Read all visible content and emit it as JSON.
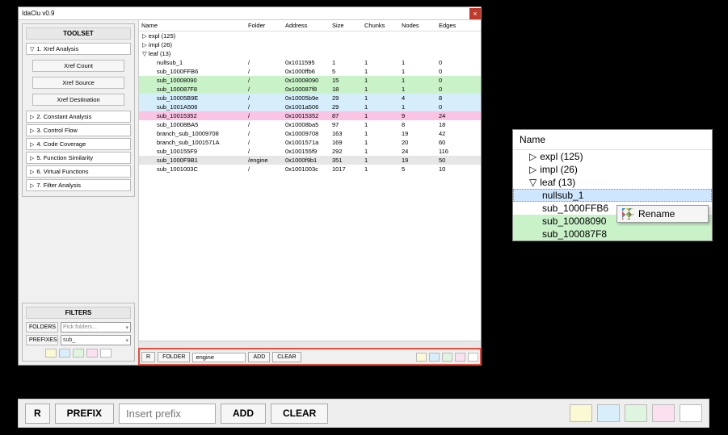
{
  "window": {
    "title": "IdaClu v0.9",
    "close": "×"
  },
  "toolset": {
    "title": "TOOLSET",
    "sections": [
      {
        "label": "1. Xref Analysis",
        "open": true,
        "items": [
          "Xref Count",
          "Xref Source",
          "Xref Destination"
        ]
      },
      {
        "label": "2. Constant Analysis",
        "open": false
      },
      {
        "label": "3. Control Flow",
        "open": false
      },
      {
        "label": "4. Code Coverage",
        "open": false
      },
      {
        "label": "5. Function Similarity",
        "open": false
      },
      {
        "label": "6. Virtual Functions",
        "open": false
      },
      {
        "label": "7. Filter Analysis",
        "open": false
      }
    ]
  },
  "filters": {
    "title": "FILTERS",
    "folders_label": "FOLDERS",
    "folders_placeholder": "Pick folders...",
    "prefixes_label": "PREFIXES",
    "prefixes_value": "sub_"
  },
  "palette": [
    "#fbf9d4",
    "#d9eefb",
    "#dff5df",
    "#fbe0f0",
    "#ffffff"
  ],
  "columns": [
    "Name",
    "Folder",
    "Address",
    "Size",
    "Chunks",
    "Nodes",
    "Edges"
  ],
  "groups": [
    {
      "label": "expl (125)",
      "open": false
    },
    {
      "label": "impl (26)",
      "open": false
    },
    {
      "label": "leaf (13)",
      "open": true
    }
  ],
  "rows": [
    {
      "name": "nullsub_1",
      "folder": "/",
      "addr": "0x1011595",
      "size": "1",
      "chunks": "1",
      "nodes": "1",
      "edges": "0",
      "bg": "#ffffff"
    },
    {
      "name": "sub_1000FFB6",
      "folder": "/",
      "addr": "0x1000ffb6",
      "size": "5",
      "chunks": "1",
      "nodes": "1",
      "edges": "0",
      "bg": "#ffffff"
    },
    {
      "name": "sub_10008090",
      "folder": "/",
      "addr": "0x10008090",
      "size": "15",
      "chunks": "1",
      "nodes": "1",
      "edges": "0",
      "bg": "#c9f2c9"
    },
    {
      "name": "sub_100087F8",
      "folder": "/",
      "addr": "0x100087f8",
      "size": "18",
      "chunks": "1",
      "nodes": "1",
      "edges": "0",
      "bg": "#c9f2c9"
    },
    {
      "name": "sub_10005B9E",
      "folder": "/",
      "addr": "0x10005b9e",
      "size": "29",
      "chunks": "1",
      "nodes": "4",
      "edges": "8",
      "bg": "#d6eefc"
    },
    {
      "name": "sub_1001A506",
      "folder": "/",
      "addr": "0x1001a506",
      "size": "29",
      "chunks": "1",
      "nodes": "1",
      "edges": "0",
      "bg": "#d6eefc"
    },
    {
      "name": "sub_10015352",
      "folder": "/",
      "addr": "0x10015352",
      "size": "87",
      "chunks": "1",
      "nodes": "9",
      "edges": "24",
      "bg": "#fbc3e4"
    },
    {
      "name": "sub_10008BA5",
      "folder": "/",
      "addr": "0x10008ba5",
      "size": "97",
      "chunks": "1",
      "nodes": "8",
      "edges": "18",
      "bg": "#ffffff"
    },
    {
      "name": "branch_sub_10009708",
      "folder": "/",
      "addr": "0x10009708",
      "size": "163",
      "chunks": "1",
      "nodes": "19",
      "edges": "42",
      "bg": "#ffffff"
    },
    {
      "name": "branch_sub_1001571A",
      "folder": "/",
      "addr": "0x1001571a",
      "size": "169",
      "chunks": "1",
      "nodes": "20",
      "edges": "60",
      "bg": "#ffffff"
    },
    {
      "name": "sub_100155F9",
      "folder": "/",
      "addr": "0x100155f9",
      "size": "292",
      "chunks": "1",
      "nodes": "24",
      "edges": "116",
      "bg": "#ffffff"
    },
    {
      "name": "sub_1000F9B1",
      "folder": "/engine",
      "addr": "0x1000f9b1",
      "size": "351",
      "chunks": "1",
      "nodes": "19",
      "edges": "50",
      "bg": "#e6e6e6"
    },
    {
      "name": "sub_1001003C",
      "folder": "/",
      "addr": "0x1001003c",
      "size": "1017",
      "chunks": "1",
      "nodes": "5",
      "edges": "10",
      "bg": "#ffffff"
    }
  ],
  "footer": {
    "r": "R",
    "folder_btn": "FOLDER",
    "folder_value": "engine",
    "add": "ADD",
    "clear": "CLEAR"
  },
  "treepanel": {
    "header": "Name",
    "nodes": [
      {
        "label": "expl (125)",
        "tri": "▷",
        "lvl": 1
      },
      {
        "label": "impl (26)",
        "tri": "▷",
        "lvl": 1
      },
      {
        "label": "leaf (13)",
        "tri": "▽",
        "lvl": 1
      }
    ],
    "leaves": [
      {
        "label": "nullsub_1",
        "bg": "#cfe6ff",
        "selected": true
      },
      {
        "label": "sub_1000FFB6",
        "bg": "#ffffff"
      },
      {
        "label": "sub_10008090",
        "bg": "#c9f2c9"
      },
      {
        "label": "sub_100087F8",
        "bg": "#c9f2c9"
      }
    ],
    "menu": {
      "label": "Rename"
    }
  },
  "bottombar": {
    "r": "R",
    "prefix": "PREFIX",
    "placeholder": "Insert prefix",
    "add": "ADD",
    "clear": "CLEAR"
  }
}
